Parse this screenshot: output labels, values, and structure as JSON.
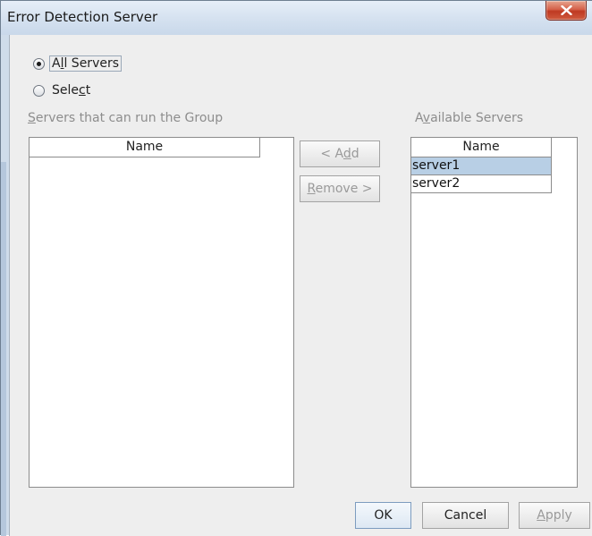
{
  "window": {
    "title": "Error Detection Server"
  },
  "options": {
    "all_servers": {
      "pre": "A",
      "key": "l",
      "post": "l Servers",
      "checked": true
    },
    "select": {
      "pre": "Sele",
      "key": "c",
      "post": "t",
      "checked": false
    }
  },
  "left_panel": {
    "label_key": "S",
    "label_rest": "ervers that can run the Group",
    "column_header": "Name",
    "rows": []
  },
  "right_panel": {
    "label_pre": "A",
    "label_key": "v",
    "label_post": "ailable Servers",
    "column_header": "Name",
    "rows": [
      {
        "name": "server1",
        "selected": true
      },
      {
        "name": "server2",
        "selected": false
      }
    ]
  },
  "middle_buttons": {
    "add": {
      "pre": "< A",
      "key": "d",
      "post": "d",
      "enabled": false
    },
    "remove": {
      "pre": "",
      "key": "R",
      "post": "emove >",
      "enabled": false
    }
  },
  "footer_buttons": {
    "ok": "OK",
    "cancel": "Cancel",
    "apply": {
      "key": "A",
      "post": "pply",
      "enabled": false
    }
  },
  "colors": {
    "selection": "#b8cfe5",
    "close_button": "#c9462c",
    "disabled_text": "#9a9a9a"
  },
  "icons": {
    "close": "x-icon"
  }
}
